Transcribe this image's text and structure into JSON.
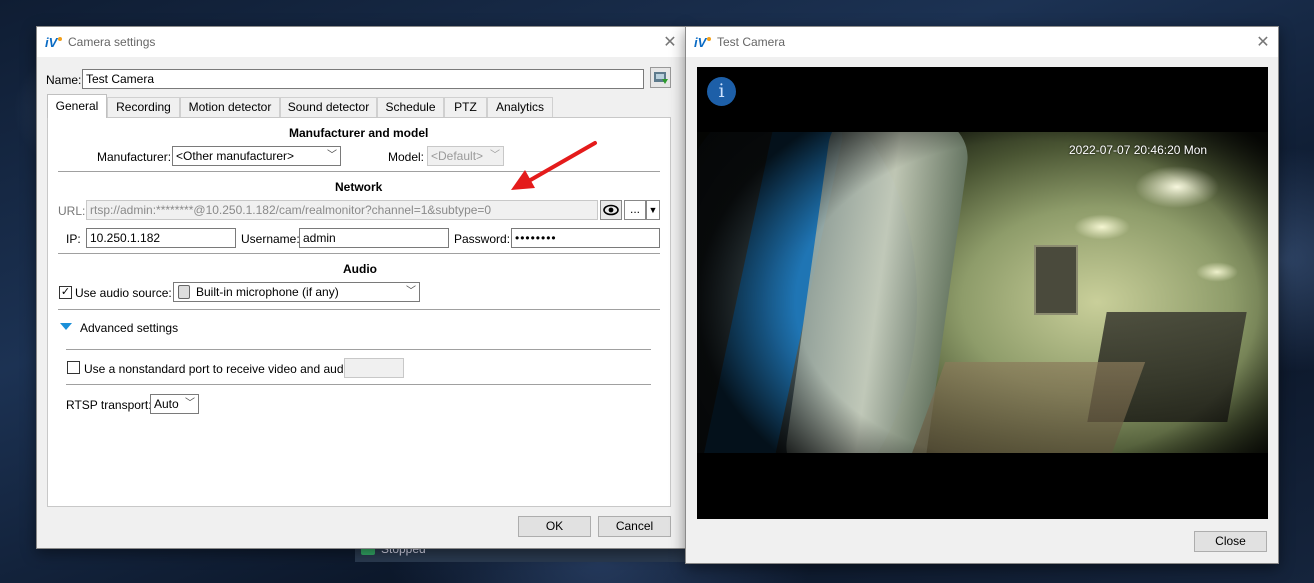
{
  "settings_window": {
    "title": "Camera settings",
    "name_label": "Name:",
    "name_value": "Test Camera",
    "tabs": [
      "General",
      "Recording",
      "Motion detector",
      "Sound detector",
      "Schedule",
      "PTZ",
      "Analytics"
    ],
    "manufacturer_section": {
      "heading": "Manufacturer and model",
      "manufacturer_label": "Manufacturer:",
      "manufacturer_value": "<Other manufacturer>",
      "model_label": "Model:",
      "model_value": "<Default>"
    },
    "network_section": {
      "heading": "Network",
      "url_label": "URL:",
      "url_value": "rtsp://admin:********@10.250.1.182/cam/realmonitor?channel=1&subtype=0",
      "more_button": "...",
      "ip_label": "IP:",
      "ip_value": "10.250.1.182",
      "username_label": "Username:",
      "username_value": "admin",
      "password_label": "Password:",
      "password_value": "••••••••"
    },
    "audio_section": {
      "heading": "Audio",
      "use_audio_label": "Use audio source:",
      "use_audio_checked": true,
      "audio_source_value": "Built-in microphone (if any)"
    },
    "advanced": {
      "label": "Advanced settings",
      "nonstandard_port_label": "Use a nonstandard port to receive video and audio:",
      "nonstandard_port_checked": false,
      "port_value": "",
      "rtsp_transport_label": "RTSP transport:",
      "rtsp_transport_value": "Auto"
    },
    "ok_button": "OK",
    "cancel_button": "Cancel"
  },
  "preview_window": {
    "title": "Test Camera",
    "timestamp": "2022-07-07 20:46:20 Mon",
    "close_button": "Close"
  },
  "background_status": "Stopped",
  "colors": {
    "accent_blue": "#0066b3",
    "arrow_red": "#e41b1b",
    "video_black": "#000000"
  }
}
